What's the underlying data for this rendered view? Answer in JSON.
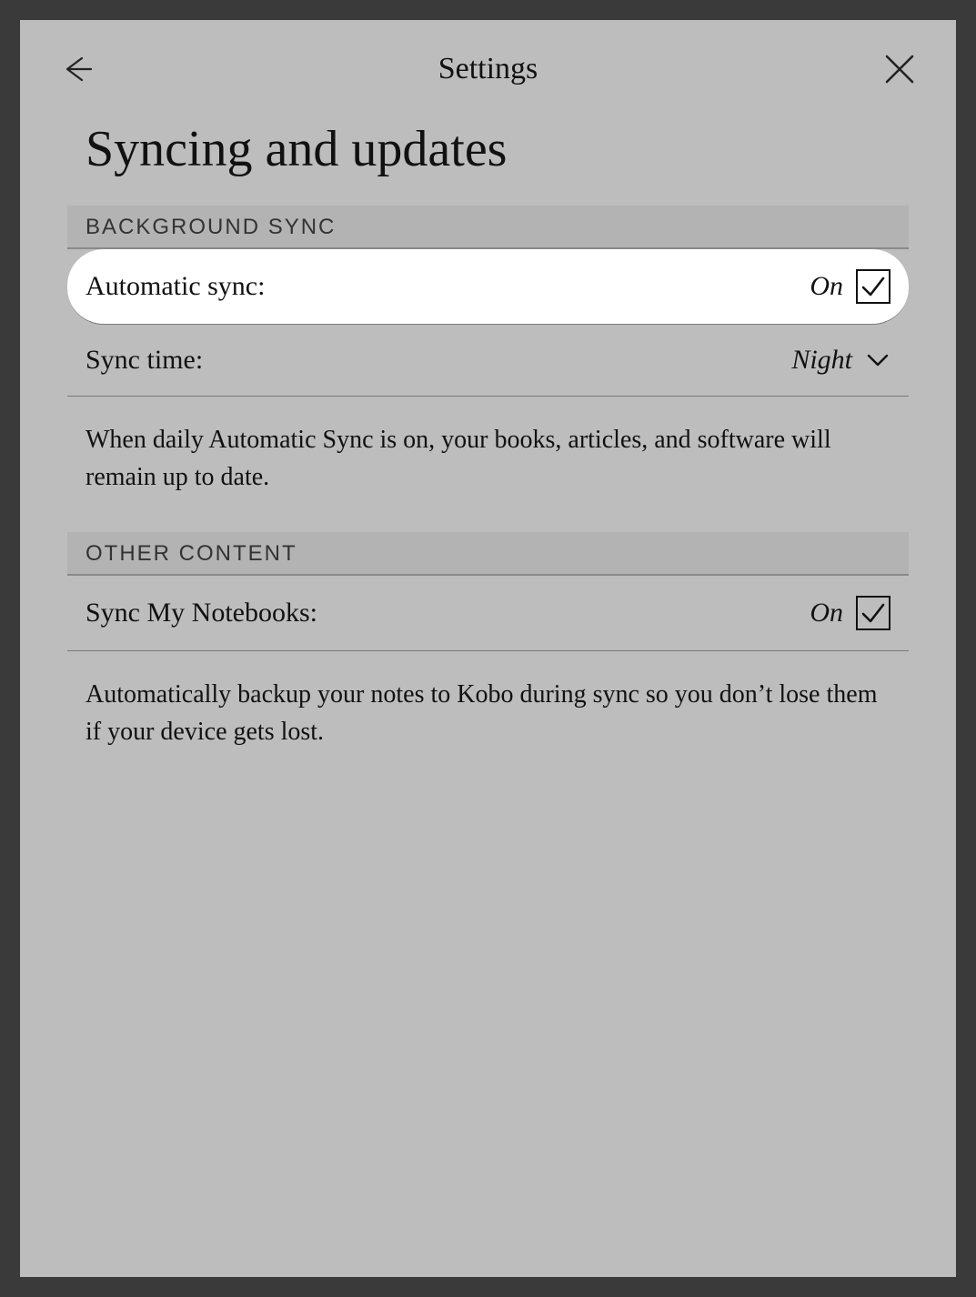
{
  "topbar": {
    "title": "Settings"
  },
  "page": {
    "title": "Syncing and updates"
  },
  "section1": {
    "header": "BACKGROUND SYNC",
    "autoSync": {
      "label": "Automatic sync:",
      "value": "On"
    },
    "syncTime": {
      "label": "Sync time:",
      "value": "Night"
    },
    "desc": "When daily Automatic Sync is on, your books, articles, and software will remain up to date."
  },
  "section2": {
    "header": "OTHER CONTENT",
    "notebooks": {
      "label": "Sync My Notebooks:",
      "value": "On"
    },
    "desc": "Automatically backup your notes to Kobo during sync so you don’t lose them if your device gets lost."
  }
}
